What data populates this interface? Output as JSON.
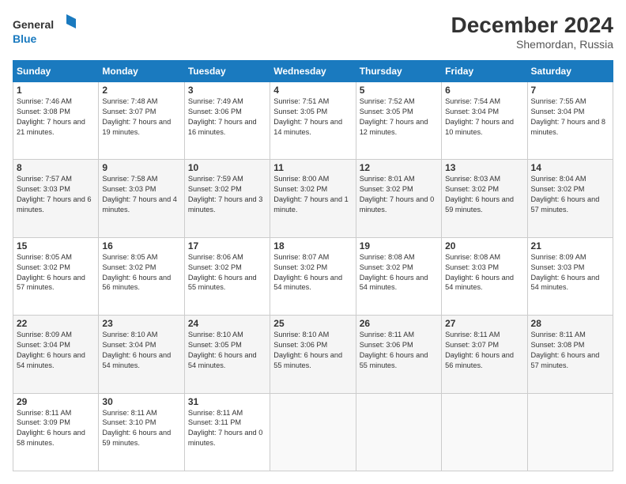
{
  "logo": {
    "general": "General",
    "blue": "Blue"
  },
  "title": "December 2024",
  "subtitle": "Shemordan, Russia",
  "days": [
    "Sunday",
    "Monday",
    "Tuesday",
    "Wednesday",
    "Thursday",
    "Friday",
    "Saturday"
  ],
  "weeks": [
    [
      {
        "day": "1",
        "sunrise": "7:46 AM",
        "sunset": "3:08 PM",
        "daylight": "7 hours and 21 minutes."
      },
      {
        "day": "2",
        "sunrise": "7:48 AM",
        "sunset": "3:07 PM",
        "daylight": "7 hours and 19 minutes."
      },
      {
        "day": "3",
        "sunrise": "7:49 AM",
        "sunset": "3:06 PM",
        "daylight": "7 hours and 16 minutes."
      },
      {
        "day": "4",
        "sunrise": "7:51 AM",
        "sunset": "3:05 PM",
        "daylight": "7 hours and 14 minutes."
      },
      {
        "day": "5",
        "sunrise": "7:52 AM",
        "sunset": "3:05 PM",
        "daylight": "7 hours and 12 minutes."
      },
      {
        "day": "6",
        "sunrise": "7:54 AM",
        "sunset": "3:04 PM",
        "daylight": "7 hours and 10 minutes."
      },
      {
        "day": "7",
        "sunrise": "7:55 AM",
        "sunset": "3:04 PM",
        "daylight": "7 hours and 8 minutes."
      }
    ],
    [
      {
        "day": "8",
        "sunrise": "7:57 AM",
        "sunset": "3:03 PM",
        "daylight": "7 hours and 6 minutes."
      },
      {
        "day": "9",
        "sunrise": "7:58 AM",
        "sunset": "3:03 PM",
        "daylight": "7 hours and 4 minutes."
      },
      {
        "day": "10",
        "sunrise": "7:59 AM",
        "sunset": "3:02 PM",
        "daylight": "7 hours and 3 minutes."
      },
      {
        "day": "11",
        "sunrise": "8:00 AM",
        "sunset": "3:02 PM",
        "daylight": "7 hours and 1 minute."
      },
      {
        "day": "12",
        "sunrise": "8:01 AM",
        "sunset": "3:02 PM",
        "daylight": "7 hours and 0 minutes."
      },
      {
        "day": "13",
        "sunrise": "8:03 AM",
        "sunset": "3:02 PM",
        "daylight": "6 hours and 59 minutes."
      },
      {
        "day": "14",
        "sunrise": "8:04 AM",
        "sunset": "3:02 PM",
        "daylight": "6 hours and 57 minutes."
      }
    ],
    [
      {
        "day": "15",
        "sunrise": "8:05 AM",
        "sunset": "3:02 PM",
        "daylight": "6 hours and 57 minutes."
      },
      {
        "day": "16",
        "sunrise": "8:05 AM",
        "sunset": "3:02 PM",
        "daylight": "6 hours and 56 minutes."
      },
      {
        "day": "17",
        "sunrise": "8:06 AM",
        "sunset": "3:02 PM",
        "daylight": "6 hours and 55 minutes."
      },
      {
        "day": "18",
        "sunrise": "8:07 AM",
        "sunset": "3:02 PM",
        "daylight": "6 hours and 54 minutes."
      },
      {
        "day": "19",
        "sunrise": "8:08 AM",
        "sunset": "3:02 PM",
        "daylight": "6 hours and 54 minutes."
      },
      {
        "day": "20",
        "sunrise": "8:08 AM",
        "sunset": "3:03 PM",
        "daylight": "6 hours and 54 minutes."
      },
      {
        "day": "21",
        "sunrise": "8:09 AM",
        "sunset": "3:03 PM",
        "daylight": "6 hours and 54 minutes."
      }
    ],
    [
      {
        "day": "22",
        "sunrise": "8:09 AM",
        "sunset": "3:04 PM",
        "daylight": "6 hours and 54 minutes."
      },
      {
        "day": "23",
        "sunrise": "8:10 AM",
        "sunset": "3:04 PM",
        "daylight": "6 hours and 54 minutes."
      },
      {
        "day": "24",
        "sunrise": "8:10 AM",
        "sunset": "3:05 PM",
        "daylight": "6 hours and 54 minutes."
      },
      {
        "day": "25",
        "sunrise": "8:10 AM",
        "sunset": "3:06 PM",
        "daylight": "6 hours and 55 minutes."
      },
      {
        "day": "26",
        "sunrise": "8:11 AM",
        "sunset": "3:06 PM",
        "daylight": "6 hours and 55 minutes."
      },
      {
        "day": "27",
        "sunrise": "8:11 AM",
        "sunset": "3:07 PM",
        "daylight": "6 hours and 56 minutes."
      },
      {
        "day": "28",
        "sunrise": "8:11 AM",
        "sunset": "3:08 PM",
        "daylight": "6 hours and 57 minutes."
      }
    ],
    [
      {
        "day": "29",
        "sunrise": "8:11 AM",
        "sunset": "3:09 PM",
        "daylight": "6 hours and 58 minutes."
      },
      {
        "day": "30",
        "sunrise": "8:11 AM",
        "sunset": "3:10 PM",
        "daylight": "6 hours and 59 minutes."
      },
      {
        "day": "31",
        "sunrise": "8:11 AM",
        "sunset": "3:11 PM",
        "daylight": "7 hours and 0 minutes."
      },
      null,
      null,
      null,
      null
    ]
  ],
  "labels": {
    "sunrise": "Sunrise:",
    "sunset": "Sunset:",
    "daylight": "Daylight hours"
  }
}
